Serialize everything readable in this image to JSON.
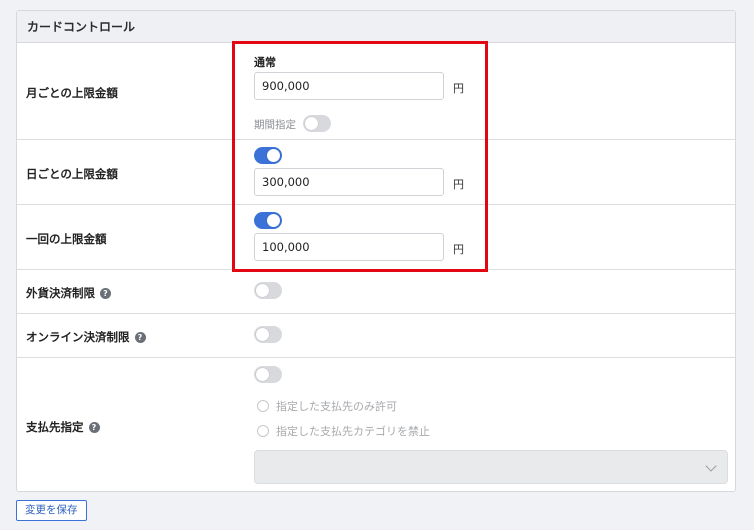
{
  "panel": {
    "title": "カードコントロール"
  },
  "monthly": {
    "label": "月ごとの上限金額",
    "normal_label": "通常",
    "value": "900,000",
    "unit": "円",
    "period_label": "期間指定",
    "period_enabled": false
  },
  "daily": {
    "label": "日ごとの上限金額",
    "enabled": true,
    "value": "300,000",
    "unit": "円"
  },
  "per_transaction": {
    "label": "一回の上限金額",
    "enabled": true,
    "value": "100,000",
    "unit": "円"
  },
  "foreign_currency": {
    "label": "外貨決済制限",
    "help_icon": "?",
    "enabled": false
  },
  "online": {
    "label": "オンライン決済制限",
    "help_icon": "?",
    "enabled": false
  },
  "payee": {
    "label": "支払先指定",
    "help_icon": "?",
    "enabled": false,
    "options": [
      "指定した支払先のみ許可",
      "指定した支払先カテゴリを禁止"
    ],
    "select_value": ""
  },
  "actions": {
    "save_label": "変更を保存"
  },
  "colors": {
    "toggle_on": "#3a72d8",
    "highlight": "#e30613"
  }
}
